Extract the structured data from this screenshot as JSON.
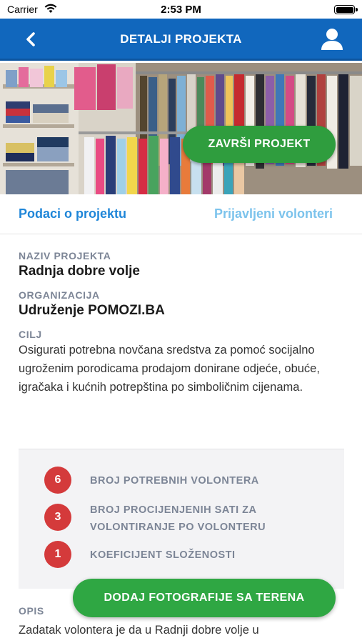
{
  "status_bar": {
    "carrier": "Carrier",
    "time": "2:53 PM"
  },
  "header": {
    "title": "DETALJI PROJEKTA",
    "back_icon": "chevron-left-icon",
    "profile_icon": "user-icon"
  },
  "hero": {
    "finish_button_label": "ZAVRŠI PROJEKT"
  },
  "tabs": [
    {
      "label": "Podaci o projektu",
      "active": true
    },
    {
      "label": "Prijavljeni volonteri",
      "active": false
    }
  ],
  "project": {
    "name_label": "NAZIV PROJEKTA",
    "name": "Radnja dobre volje",
    "org_label": "ORGANIZACIJA",
    "org": "Udruženje POMOZI.BA",
    "goal_label": "CILJ",
    "goal": "Osigurati potrebna novčana sredstva za pomoć socijalno ugroženim porodicama prodajom donirane odjeće, obuće, igračaka i kućnih potrepština po simboličnim cijenama."
  },
  "stats": [
    {
      "value": "6",
      "label": "BROJ POTREBNIH VOLONTERA"
    },
    {
      "value": "3",
      "label": "BROJ PROCIJENJENIH SATI ZA VOLONTIRANJE PO VOLONTERU"
    },
    {
      "value": "1",
      "label": "KOEFICIJENT SLOŽENOSTI"
    }
  ],
  "description": {
    "label": "OPIS",
    "text": "Zadatak volontera je da u Radnji dobre volje u"
  },
  "add_photos_button_label": "DODAJ FOTOGRAFIJE SA TERENA",
  "colors": {
    "nav_blue": "#1167bd",
    "tab_active": "#1f86d8",
    "tab_inactive": "#7cc3ec",
    "button_green": "#2fa743",
    "badge_red": "#d43a3b",
    "label_gray": "#7c8596"
  }
}
